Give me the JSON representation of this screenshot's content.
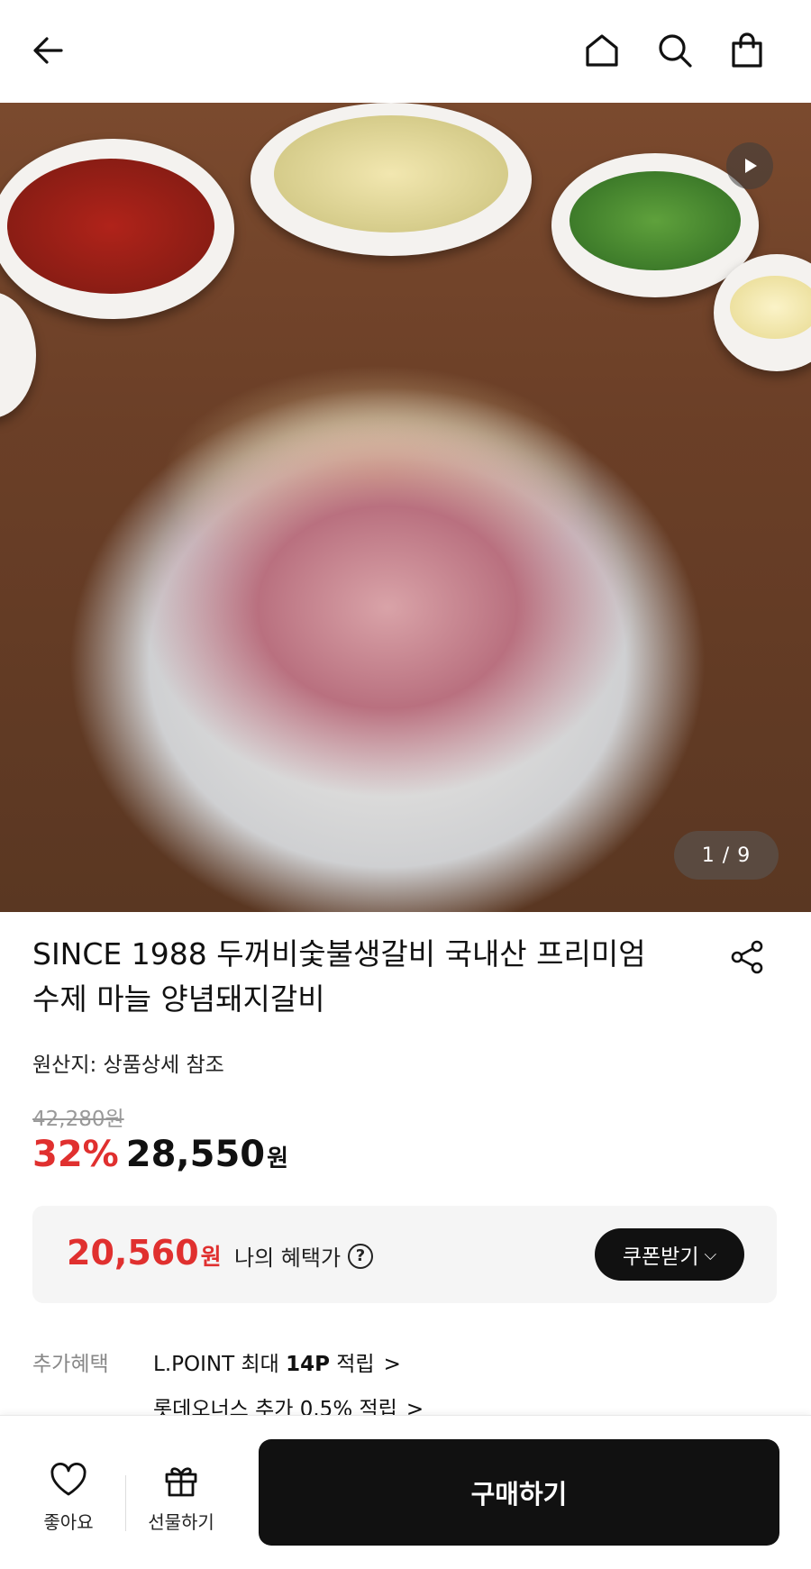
{
  "header": {
    "back_icon": "arrow-left-icon",
    "home_icon": "home-icon",
    "search_icon": "search-icon",
    "cart_icon": "shopping-bag-icon"
  },
  "gallery": {
    "play_icon": "play-icon",
    "page_indicator": "1 / 9"
  },
  "product": {
    "title": "SINCE 1988 두꺼비숯불생갈비 국내산 프리미엄 수제 마늘 양념돼지갈비",
    "share_icon": "share-icon",
    "origin": "원산지: 상품상세 참조",
    "original_price": "42,280원",
    "discount": "32%",
    "price": "28,550",
    "currency": "원"
  },
  "benefit": {
    "price": "20,560",
    "currency": "원",
    "label": "나의 혜택가",
    "help": "?",
    "coupon_label": "쿠폰받기"
  },
  "extra": {
    "label": "추가혜택",
    "item1_prefix": "L.POINT 최대 ",
    "item1_bold": "14P",
    "item1_suffix": " 적립",
    "item2": "롯데오너스 추가 0.5% 적립",
    "chevron": ">"
  },
  "bottom": {
    "like_label": "좋아요",
    "gift_label": "선물하기",
    "buy_label": "구매하기"
  },
  "colors": {
    "accent_red": "#e0302f",
    "dark": "#111111"
  }
}
